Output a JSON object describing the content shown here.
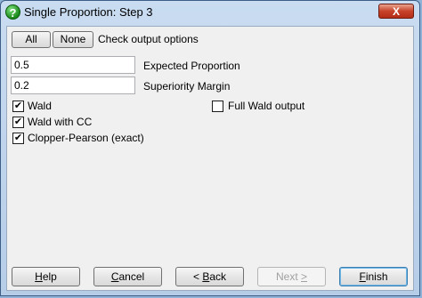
{
  "window": {
    "title": "Single Proportion: Step 3",
    "close_label": "X"
  },
  "toolbar": {
    "all_label": "All",
    "none_label": "None",
    "hint": "Check output options"
  },
  "fields": {
    "expected_proportion": {
      "value": "0.5",
      "label": "Expected Proportion"
    },
    "superiority_margin": {
      "value": "0.2",
      "label": "Superiority Margin"
    }
  },
  "options": {
    "wald": {
      "label": "Wald",
      "checked": true
    },
    "wald_cc": {
      "label": "Wald with CC",
      "checked": true
    },
    "clopper_pearson": {
      "label": "Clopper-Pearson (exact)",
      "checked": true
    },
    "full_wald": {
      "label": "Full Wald output",
      "checked": false
    }
  },
  "buttons": {
    "help": {
      "key": "H",
      "rest": "elp"
    },
    "cancel": {
      "key": "C",
      "rest": "ancel"
    },
    "back": {
      "prefix": "< ",
      "key": "B",
      "rest": "ack"
    },
    "next": {
      "prefix": "Next ",
      "key": ">",
      "rest": ""
    },
    "finish": {
      "key": "F",
      "rest": "inish"
    }
  },
  "colors": {
    "frame": "#b6cde8",
    "close_button": "#c7432a",
    "client": "#f0f0f0"
  }
}
